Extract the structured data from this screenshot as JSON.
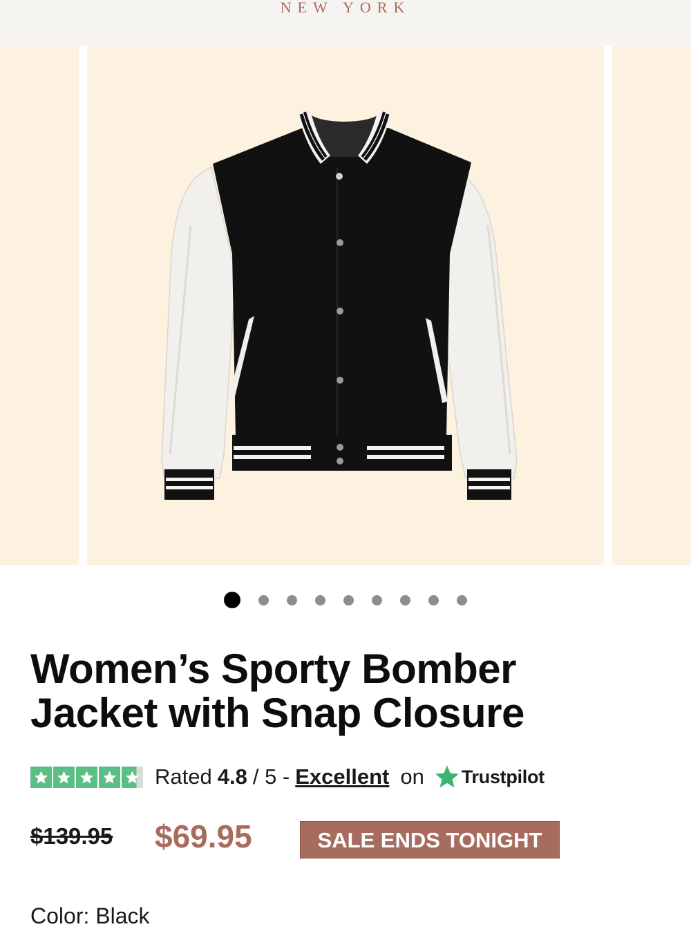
{
  "header": {
    "brand_subtitle": "NEW YORK"
  },
  "gallery": {
    "slide_count": 9,
    "active_index": 0,
    "image_icon": "varsity-bomber-jacket-image"
  },
  "product": {
    "title": "Women’s Sporty Bomber Jacket with Snap Closure",
    "rating": {
      "prefix": "Rated",
      "value": "4.8",
      "scale": "/ 5 -",
      "label": "Excellent",
      "on": "on",
      "provider": "Trustpilot",
      "stars_filled": 4.8,
      "stars_total": 5,
      "star_color": "#5bbe85"
    },
    "price": {
      "original": "$139.95",
      "sale": "$69.95",
      "badge": "SALE ENDS TONIGHT"
    },
    "color_label": "Color: Black"
  },
  "colors": {
    "accent": "#a86c5e",
    "slide_background": "#fdf1df",
    "topbar_background": "#f6f4f1"
  }
}
